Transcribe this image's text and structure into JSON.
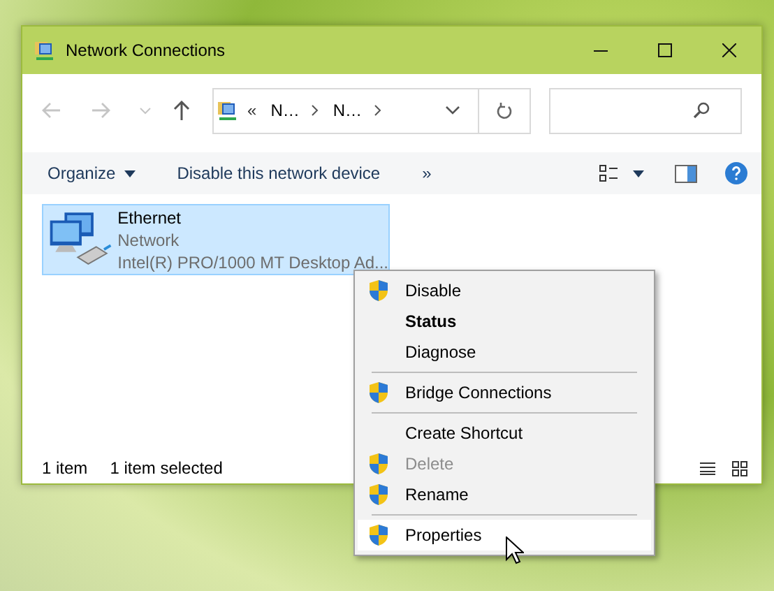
{
  "window": {
    "title": "Network Connections"
  },
  "navigation": {
    "back": {
      "disabled": true
    },
    "forward": {
      "disabled": true
    },
    "address_prefix": "«",
    "crumbs": [
      "N…",
      "N…"
    ]
  },
  "toolbar": {
    "buttons": [
      {
        "label": "Organize",
        "has_menu": true
      },
      {
        "label": "Disable this network device",
        "has_menu": false
      },
      {
        "label": "»",
        "has_menu": false
      }
    ]
  },
  "items": [
    {
      "name": "Ethernet",
      "type": "Network",
      "device": "Intel(R) PRO/1000 MT Desktop Ad...",
      "selected": true
    }
  ],
  "status_bar": {
    "count": "1 item",
    "selection": "1 item selected"
  },
  "context_menu": [
    {
      "kind": "item",
      "label": "Disable",
      "shield": true,
      "bold": false,
      "disabled": false,
      "selected": false
    },
    {
      "kind": "item",
      "label": "Status",
      "shield": false,
      "bold": true,
      "disabled": false,
      "selected": false
    },
    {
      "kind": "item",
      "label": "Diagnose",
      "shield": false,
      "bold": false,
      "disabled": false,
      "selected": false
    },
    {
      "kind": "separator"
    },
    {
      "kind": "item",
      "label": "Bridge Connections",
      "shield": true,
      "bold": false,
      "disabled": false,
      "selected": false
    },
    {
      "kind": "separator"
    },
    {
      "kind": "item",
      "label": "Create Shortcut",
      "shield": false,
      "bold": false,
      "disabled": false,
      "selected": false
    },
    {
      "kind": "item",
      "label": "Delete",
      "shield": true,
      "bold": false,
      "disabled": true,
      "selected": false
    },
    {
      "kind": "item",
      "label": "Rename",
      "shield": true,
      "bold": false,
      "disabled": false,
      "selected": false
    },
    {
      "kind": "separator"
    },
    {
      "kind": "item",
      "label": "Properties",
      "shield": true,
      "bold": false,
      "disabled": false,
      "selected": true
    }
  ]
}
